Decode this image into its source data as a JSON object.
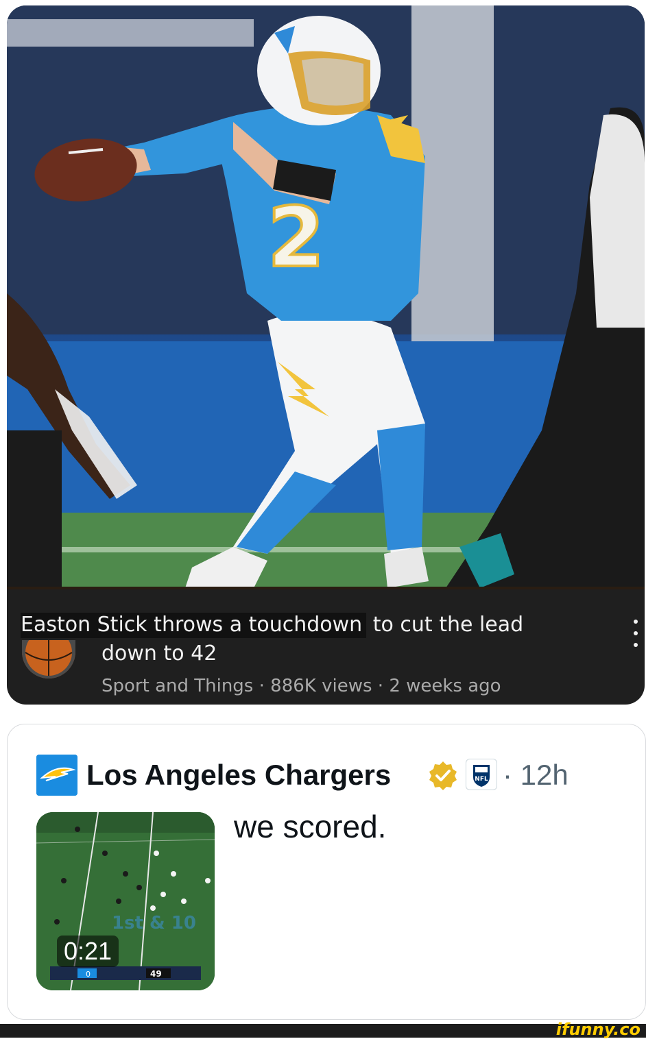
{
  "video": {
    "title_part1": "Easton Stick throws a touchdown",
    "title_part2": " to cut the lead",
    "title_line2": "down to 42",
    "channel": "Sport and Things",
    "views": "886K views",
    "age": "2 weeks ago",
    "meta_separator": " · ",
    "menu_icon": "kebab-menu-icon"
  },
  "tweet": {
    "author": "Los Angeles Chargers",
    "time": "· 12h",
    "text": "we scored.",
    "duration": "0:21",
    "verified_color": "#e8b829",
    "avatar_color": "#1a8ce0"
  },
  "watermark": "ifunny.co"
}
